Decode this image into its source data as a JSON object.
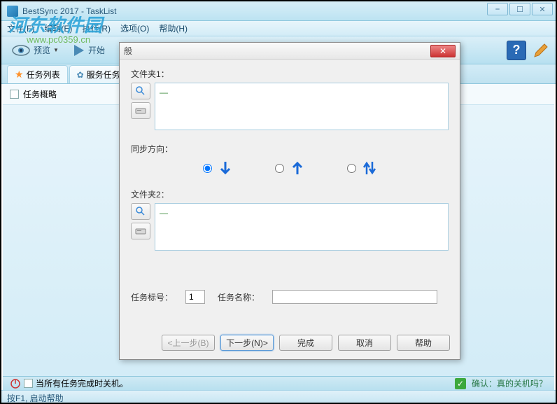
{
  "window": {
    "title": "BestSync 2017 - TaskList",
    "minimize": "⎯",
    "maximize": "☐",
    "close": "✕"
  },
  "menu": {
    "file": "文件(F)",
    "edit": "编辑(E)",
    "execute": "执行(R)",
    "options": "选项(O)",
    "help": "帮助(H)"
  },
  "toolbar": {
    "preview": "预览",
    "start": "开始"
  },
  "tabs": {
    "tasklist": "任务列表",
    "servicetask": "服务任务"
  },
  "tasklist": {
    "overview": "任务概略"
  },
  "bottom": {
    "shutdown": "当所有任务完成时关机。",
    "confirm": "确认：真的关机吗？"
  },
  "status": {
    "help": "按F1, 启动帮助"
  },
  "watermark": {
    "line1": "河东软件园",
    "line2": "www.pc0359.cn"
  },
  "dialog": {
    "title": "般",
    "folder1_label": "文件夹1：",
    "folder1_value": "—",
    "sync_label": "同步方向：",
    "folder2_label": "文件夹2：",
    "folder2_value": "—",
    "task_id_label": "任务标号：",
    "task_id_value": "1",
    "task_name_label": "任务名称：",
    "task_name_value": "",
    "prev": "<上一步(B)",
    "next": "下一步(N)>",
    "finish": "完成",
    "cancel": "取消",
    "help": "帮助"
  }
}
